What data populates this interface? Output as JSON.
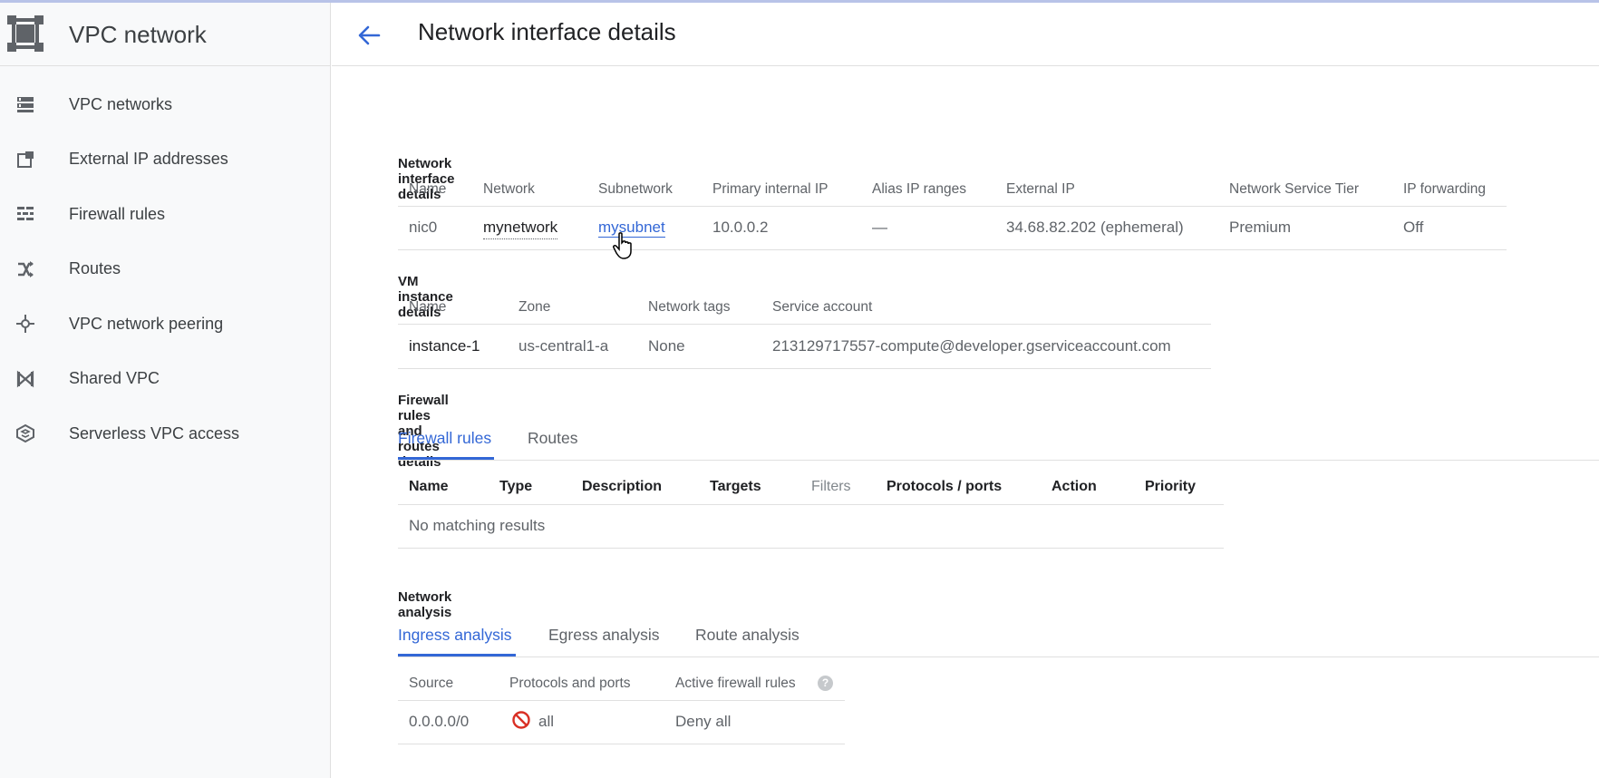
{
  "app": {
    "title": "VPC network",
    "page_title": "Network interface details"
  },
  "sidebar": {
    "items": [
      {
        "label": "VPC networks",
        "icon": "vpc-networks-icon"
      },
      {
        "label": "External IP addresses",
        "icon": "external-ip-icon"
      },
      {
        "label": "Firewall rules",
        "icon": "firewall-icon"
      },
      {
        "label": "Routes",
        "icon": "routes-icon"
      },
      {
        "label": "VPC network peering",
        "icon": "peering-icon"
      },
      {
        "label": "Shared VPC",
        "icon": "shared-vpc-icon"
      },
      {
        "label": "Serverless VPC access",
        "icon": "serverless-icon"
      }
    ]
  },
  "nic": {
    "section_title": "Network interface details",
    "headers": [
      "Name",
      "Network",
      "Subnetwork",
      "Primary internal IP",
      "Alias IP ranges",
      "External IP",
      "Network Service Tier",
      "IP forwarding"
    ],
    "row": [
      "nic0",
      "mynetwork",
      "mysubnet",
      "10.0.0.2",
      "—",
      "34.68.82.202 (ephemeral)",
      "Premium",
      "Off"
    ]
  },
  "vm": {
    "section_title": "VM instance details",
    "headers": [
      "Name",
      "Zone",
      "Network tags",
      "Service account"
    ],
    "row": [
      "instance-1",
      "us-central1-a",
      "None",
      "213129717557-compute@developer.gserviceaccount.com"
    ]
  },
  "firewall": {
    "section_title": "Firewall rules and routes details",
    "tabs": [
      "Firewall rules",
      "Routes"
    ],
    "active_tab": "Firewall rules",
    "headers": [
      "Name",
      "Type",
      "Description",
      "Targets",
      "Filters",
      "Protocols / ports",
      "Action",
      "Priority"
    ],
    "empty_text": "No matching results"
  },
  "analysis": {
    "section_title": "Network analysis",
    "tabs": [
      "Ingress analysis",
      "Egress analysis",
      "Route analysis"
    ],
    "active_tab": "Ingress analysis",
    "headers": [
      "Source",
      "Protocols and ports",
      "Active firewall rules"
    ],
    "row": [
      "0.0.0.0/0",
      "all",
      "Deny all"
    ]
  },
  "colors": {
    "accent": "#3367d6",
    "deny": "#d93025",
    "sidebar_bg": "#f8f9fa"
  }
}
